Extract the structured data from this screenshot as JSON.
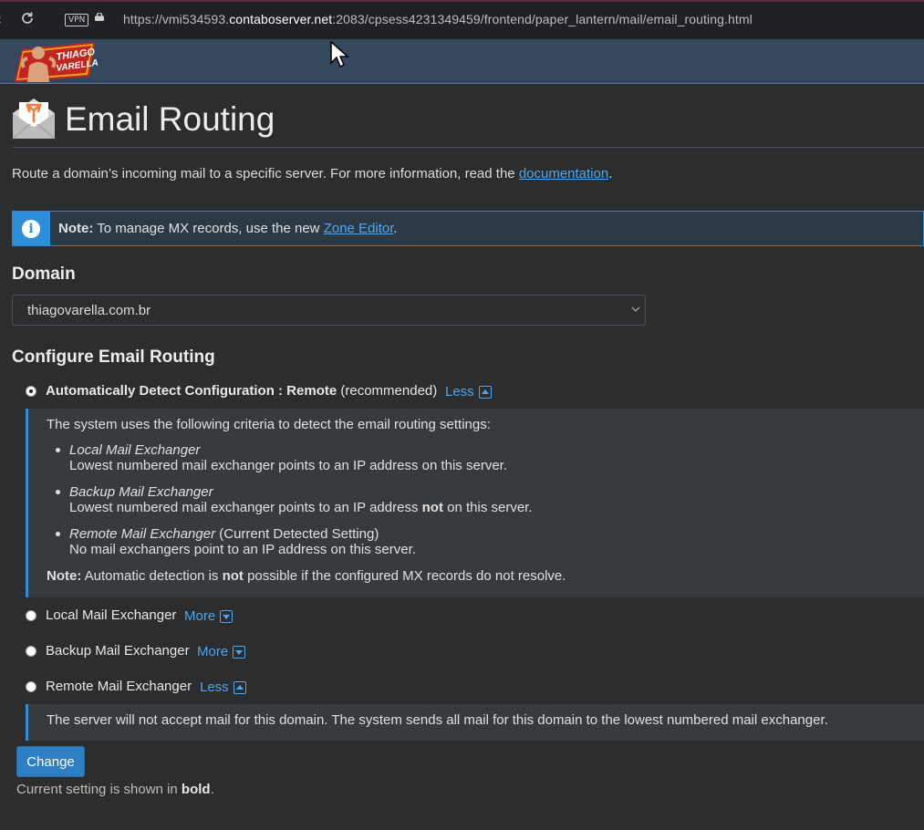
{
  "browser": {
    "url_prefix": "https://vmi534593.",
    "url_host": "contaboserver.net",
    "url_suffix": ":2083/cpsess4231349459/frontend/paper_lantern/mail/email_routing.html",
    "vpn_label": "VPN"
  },
  "header": {
    "logo_line1": "THIAGO",
    "logo_line2": "VARELLA"
  },
  "page": {
    "title": "Email Routing",
    "intro_text": "Route a domain’s incoming mail to a specific server. For more information, read the ",
    "intro_link": "documentation",
    "intro_end": "."
  },
  "alert": {
    "label": "Note:",
    "text": " To manage MX records, use the new ",
    "link": "Zone Editor",
    "end": "."
  },
  "domain": {
    "heading": "Domain",
    "selected": "thiagovarella.com.br"
  },
  "routing": {
    "heading": "Configure Email Routing",
    "options": [
      {
        "label_bold": "Automatically Detect Configuration : Remote",
        "label_extra": " (recommended)",
        "toggle": "Less",
        "checked": true
      },
      {
        "label": "Local Mail Exchanger",
        "toggle": "More",
        "checked": false
      },
      {
        "label": "Backup Mail Exchanger",
        "toggle": "More",
        "checked": false
      },
      {
        "label": "Remote Mail Exchanger",
        "toggle": "Less",
        "checked": false
      }
    ],
    "auto_panel": {
      "intro": "The system uses the following criteria to detect the email routing settings:",
      "items": [
        {
          "title": "Local Mail Exchanger",
          "extra": "",
          "desc_pre": "Lowest numbered mail exchanger points to an IP address on this server.",
          "desc_bold": "",
          "desc_post": ""
        },
        {
          "title": "Backup Mail Exchanger",
          "extra": "",
          "desc_pre": "Lowest numbered mail exchanger points to an IP address ",
          "desc_bold": "not",
          "desc_post": " on this server."
        },
        {
          "title": "Remote Mail Exchanger",
          "extra": " (Current Detected Setting)",
          "desc_pre": "No mail exchangers point to an IP address on this server.",
          "desc_bold": "",
          "desc_post": ""
        }
      ],
      "note_label": "Note:",
      "note_pre": " Automatic detection is ",
      "note_bold": "not",
      "note_post": " possible if the configured MX records do not resolve."
    },
    "remote_panel": {
      "text": "The server will not accept mail for this domain. The system sends all mail for this domain to the lowest numbered mail exchanger."
    }
  },
  "actions": {
    "change_label": "Change",
    "footnote_pre": "Current setting is shown in ",
    "footnote_bold": "bold",
    "footnote_post": "."
  },
  "colors": {
    "page_bg": "#2b2d2f",
    "header_bg": "#34495e",
    "accent": "#2c8fd8",
    "link": "#4ea7f0",
    "button": "#2d7ec2"
  }
}
